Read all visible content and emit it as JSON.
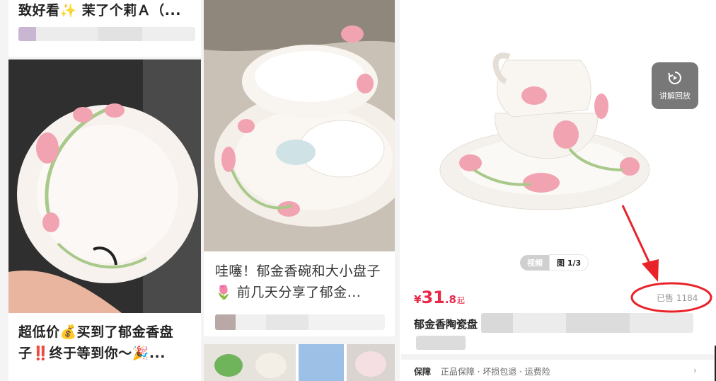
{
  "feed": {
    "top_left_title": "致好看✨ 茉了个莉Ａ（...",
    "left_card_title": "超低价💰买到了郁金香盘子‼️终于等到你～🎉...",
    "right_card_title": "哇噻！郁金香碗和大小盘子🌷 前几天分享了郁金..."
  },
  "product": {
    "media_tab_video": "视频",
    "media_tab_image": "图 1/3",
    "replay_label": "讲解回放",
    "price_symbol": "¥",
    "price_int": "31",
    "price_dec": ".8",
    "price_suffix": "起",
    "sold_text": "已售 1184",
    "title_prefix": "郁金香陶瓷盘",
    "shipping_label": "保障",
    "shipping_text": "正品保障 · 坏损包退 · 运费险",
    "more_icon": "chevron-right-icon"
  },
  "colors": {
    "price_red": "#e8294a",
    "annotation_red": "#e8232a",
    "tulip_pink": "#f2a3b1",
    "stem_green": "#a9c98a"
  }
}
